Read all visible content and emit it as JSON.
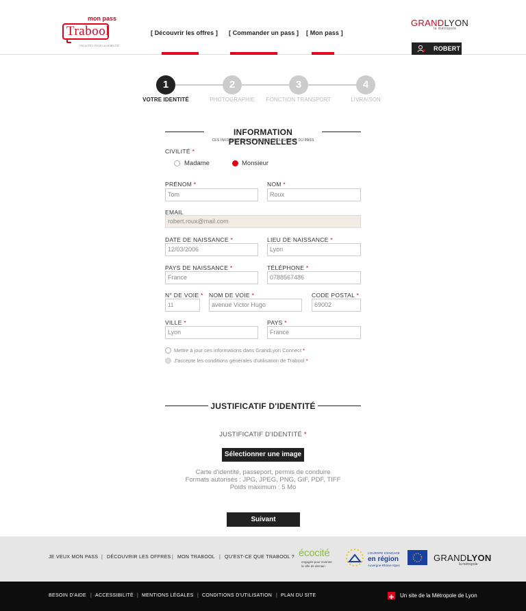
{
  "header": {
    "logo_top": "mon pass",
    "logo_main": "Trabool",
    "logo_tagline": "FACILITEZ-VOUS LA MOBILITÉ",
    "nav": [
      {
        "label": "[ Découvrir les offres ]"
      },
      {
        "label": "[ Commander un pass ]"
      },
      {
        "label": "[ Mon pass ]"
      }
    ],
    "brand_grand": "GRAND",
    "brand_lyon": "LYON",
    "brand_sub": "la métropole",
    "user_name": "ROBERT"
  },
  "stepper": [
    {
      "num": "1",
      "label": "VOTRE IDENTITÉ",
      "active": true
    },
    {
      "num": "2",
      "label": "PHOTOGRAPHIE",
      "active": false
    },
    {
      "num": "3",
      "label": "FONCTION TRANSPORT",
      "active": false
    },
    {
      "num": "4",
      "label": "LIVRAISON",
      "active": false
    }
  ],
  "personal": {
    "title": "INFORMATION PERSONNELLES",
    "subtitle": "CES INFORMATIONS CONSERNE L'UTILISATEUR DU PASS",
    "civility_label": "CIVILITÉ",
    "civility_options": [
      "Madame",
      "Monsieur"
    ],
    "civility_selected": "Monsieur",
    "required_mark": "*",
    "firstname_label": "PRÉNOM",
    "firstname_value": "Tom",
    "lastname_label": "NOM",
    "lastname_value": "Roux",
    "email_label": "EMAIL",
    "email_value": "robert.roux@mail.com",
    "birthdate_label": "DATE DE NAISSANCE",
    "birthdate_value": "12/03/2006",
    "birthplace_label": "LIEU DE NAISSANCE",
    "birthplace_value": "Lyon",
    "birthcountry_label": "PAYS DE NAISSANCE",
    "birthcountry_value": "France",
    "phone_label": "TÉLÉPHONE",
    "phone_value": "0788567486",
    "streetnum_label": "N° DE VOIE",
    "streetnum_value": "11",
    "street_label": "NOM DE VOIE",
    "street_value": "avenue Victor Hugo",
    "zip_label": "CODE POSTAL",
    "zip_value": "69002",
    "city_label": "VILLE",
    "city_value": "Lyon",
    "country_label": "PAYS",
    "country_value": "France",
    "check_update": "Mettre à jour ces informations dans GrandLyon Connect",
    "check_terms": "J'accepte les conditions générales d'utilisation de Trabool"
  },
  "identity": {
    "title": "JUSTIFICATIF D'IDENTITÉ",
    "label": "JUSTIFICATIF D'IDENTITÉ",
    "select_button": "Sélectionner une image",
    "help_line1": "Carte d'identité, passeport, permis de conduire",
    "help_line2": "Formats autorisés : JPG, JPEG, PNG, GIF, PDF, TIFF",
    "help_line3": "Poids maximum : 5 Mo",
    "next_button": "Suivant"
  },
  "footer": {
    "links1": [
      "JE VEUX MON PASS",
      "DÉCOUVRIR LES OFFRES",
      "MON TRABOOL",
      "QU'EST-CE QUE TRABOOL ?"
    ],
    "ecocite": "écocité",
    "ecocite_sub1": "engagée pour inventer",
    "ecocite_sub2": "la ville de demain",
    "region_top": "L'EUROPE S'ENGAGE",
    "region_main": "en région",
    "region_sub": "Auvergne-Rhône-Alpes",
    "gl_grand": "GRAND",
    "gl_lyon": "LYON",
    "gl_sub": "la métropole",
    "links2": [
      "BESOIN D'AIDE",
      "ACCESSIBILITÉ",
      "MENTIONS LÉGALES",
      "CONDITIONS D'UTILISATION",
      "PLAN DU SITE"
    ],
    "metropole": "Un site de la Métropole de Lyon"
  },
  "colors": {
    "accent": "#e3001b",
    "dark": "#222222",
    "disabled_field": "#f2ebe3"
  }
}
